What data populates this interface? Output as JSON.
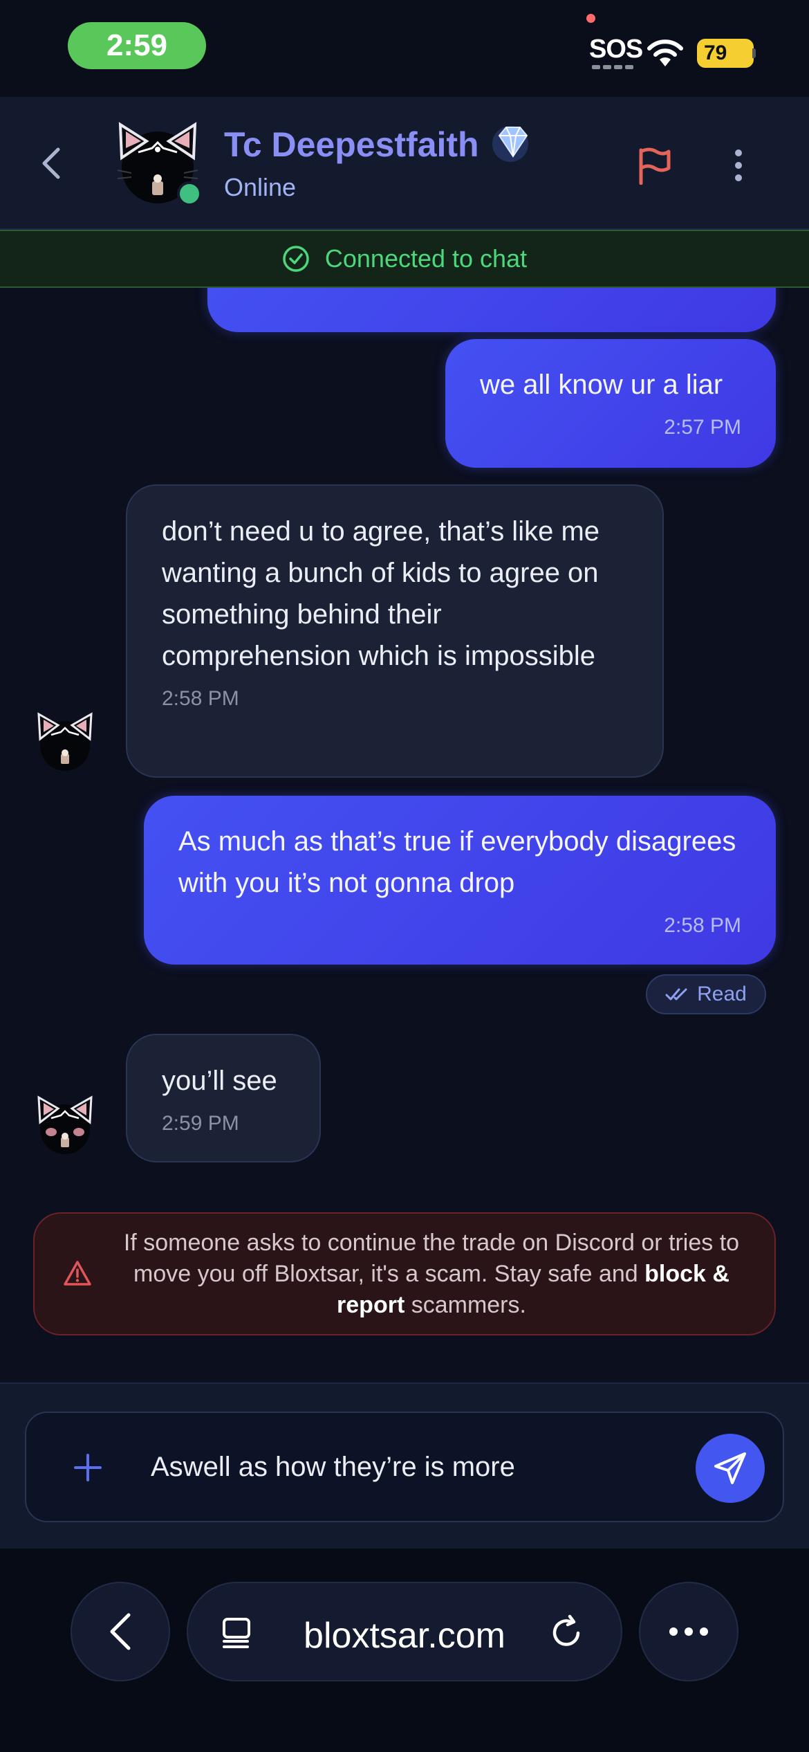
{
  "status_bar": {
    "time": "2:59",
    "sos": "SOS",
    "battery": "79"
  },
  "header": {
    "name": "Tc Deepestfaith",
    "status": "Online",
    "icons": [
      "back-chevron-icon",
      "avatar-cat",
      "diamond-icon",
      "flag-icon",
      "more-vertical-icon"
    ]
  },
  "connection": {
    "text": "Connected to chat"
  },
  "messages": [
    {
      "from": "me",
      "text": "we all know ur a liar",
      "time": "2:57 PM"
    },
    {
      "from": "them",
      "text": "don’t need u to agree, that’s like me wanting a bunch of kids to agree on something behind their comprehension which is impossible",
      "time": "2:58 PM"
    },
    {
      "from": "me",
      "text": "As much as that’s true if everybody disagrees with you it’s not gonna drop",
      "time": "2:58 PM"
    },
    {
      "from": "them",
      "text": "you’ll see",
      "time": "2:59 PM"
    }
  ],
  "read_receipt": "Read",
  "warning": {
    "text_before": "If someone asks to continue the trade on Discord or tries to move you off Bloxtsar, it's a scam. Stay safe and ",
    "bold": "block & report",
    "text_after": " scammers."
  },
  "composer": {
    "value": "Aswell as how they’re is more"
  },
  "browser": {
    "url": "bloxtsar.com"
  },
  "colors": {
    "accent": "#4356f0",
    "online": "#3fbf80",
    "connected": "#4dd77c",
    "warning": "#e0555a",
    "flag": "#e5645a"
  }
}
